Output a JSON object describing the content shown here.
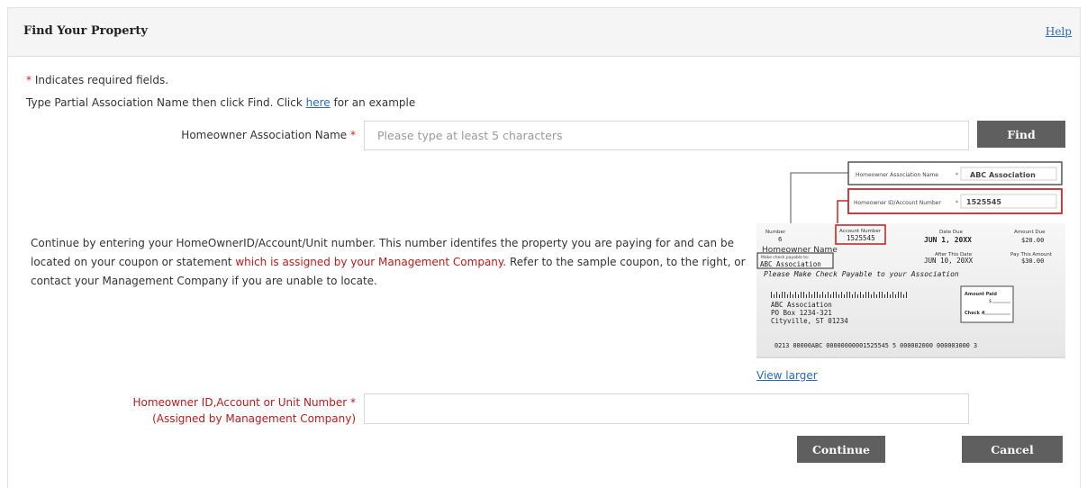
{
  "header": {
    "title": "Find Your Property",
    "help_label": "Help"
  },
  "required_note": {
    "asterisk": "*",
    "text": " Indicates required fields."
  },
  "instruction": {
    "before": "Type Partial Association Name then click Find. Click ",
    "link": "here",
    "after": " for an example"
  },
  "association_field": {
    "label": "Homeowner Association Name",
    "asterisk": "*",
    "placeholder": "Please type at least 5 characters",
    "value": ""
  },
  "find_button": "Find",
  "paragraph": {
    "part1": "Continue by entering your HomeOwnerID/Account/Unit number. This number identifes the property you are paying for and can be located on your coupon or statement ",
    "red": "which is assigned by your Management Company.",
    "part2": " Refer to the sample coupon, to the right, or contact your Management Company if you are unable to locate."
  },
  "coupon_sample": {
    "assoc_label": "Homeowner Association Name",
    "assoc_value": "ABC Association",
    "id_label": "Homeowner ID/Account Number",
    "id_value": "1525545",
    "number_label": "Number",
    "number_value": "6",
    "account_number_label": "Account Number",
    "account_number_value": "1525545",
    "date_due_label": "Date Due",
    "date_due_value": "JUN  1, 20XX",
    "amount_due_label": "Amount Due",
    "amount_due_value": "$20.00",
    "homeowner_name": "Homeowner Name",
    "payable_note": "Make check payable to:",
    "payable_assoc": "ABC Association",
    "after_this_date_label": "After This Date",
    "after_this_date_value": "JUN 10, 20XX",
    "pay_this_amount_label": "Pay This Amount",
    "pay_this_amount_value": "$30.00",
    "banner": "Please Make Check Payable to your Association",
    "address_line1": "ABC Association",
    "address_line2": "PO Box 1234-321",
    "address_line3": "Cityville, ST 01234",
    "amount_paid_label": "Amount Paid",
    "amount_paid_currency": "$",
    "check_label": "Check #",
    "micr_line": "0213  00000ABC  00000000001525545 5  000002000  000003000 3"
  },
  "view_larger": "View larger",
  "id_field": {
    "label_line1": "Homeowner ID,Account or Unit Number *",
    "label_line2": "(Assigned by Management Company)",
    "value": ""
  },
  "continue_button": "Continue",
  "cancel_button": "Cancel",
  "colors": {
    "required": "#c62828",
    "link": "#2a6ab8",
    "button": "#5f5f5f",
    "highlight": "#c62828"
  }
}
